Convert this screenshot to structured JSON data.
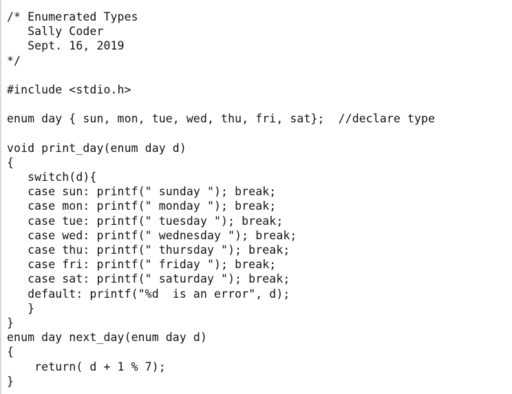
{
  "code_view": {
    "lines": [
      "/* Enumerated Types",
      "   Sally Coder",
      "   Sept. 16, 2019",
      "*/",
      "",
      "#include <stdio.h>",
      "",
      "enum day { sun, mon, tue, wed, thu, fri, sat};  //declare type",
      "",
      "void print_day(enum day d)",
      "{",
      "   switch(d){",
      "   case sun: printf(\" sunday \"); break;",
      "   case mon: printf(\" monday \"); break;",
      "   case tue: printf(\" tuesday \"); break;",
      "   case wed: printf(\" wednesday \"); break;",
      "   case thu: printf(\" thursday \"); break;",
      "   case fri: printf(\" friday \"); break;",
      "   case sat: printf(\" saturday \"); break;",
      "   default: printf(\"%d  is an error\", d);",
      "   }",
      "}",
      "enum day next_day(enum day d)",
      "{",
      "    return( d + 1 % 7);",
      "}"
    ]
  }
}
